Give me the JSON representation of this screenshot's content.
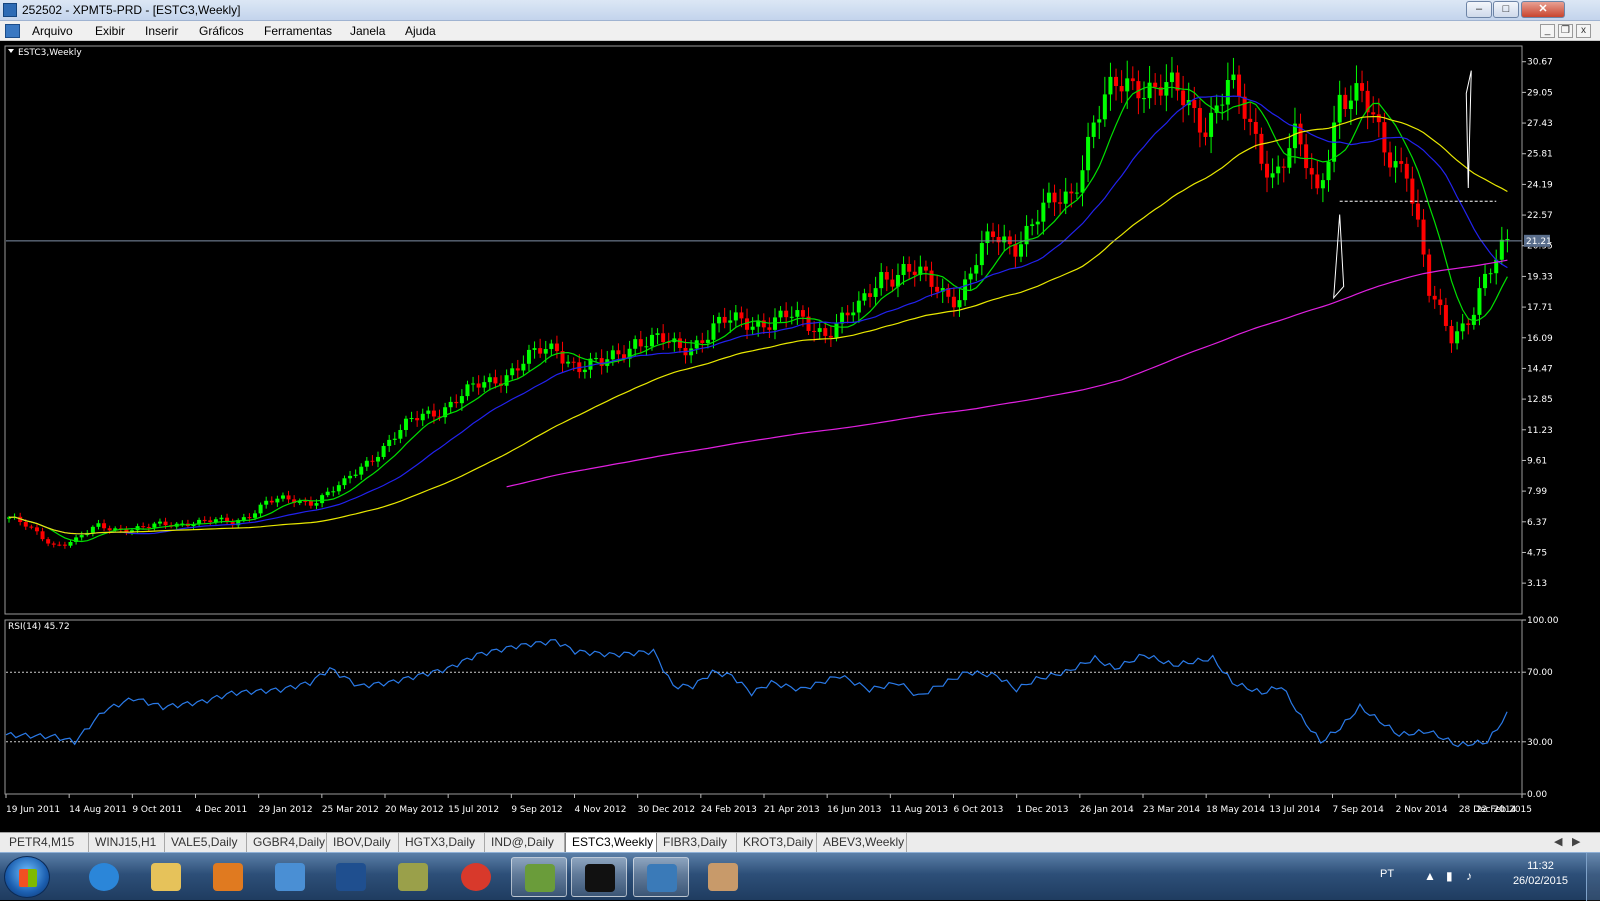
{
  "window": {
    "title": "252502 - XPMT5-PRD - [ESTC3,Weekly]"
  },
  "menu": [
    "Arquivo",
    "Exibir",
    "Inserir",
    "Gráficos",
    "Ferramentas",
    "Janela",
    "Ajuda"
  ],
  "chart_data": [
    {
      "type": "candlestick",
      "title": "ESTC3,Weekly",
      "ylim": [
        1.5,
        31.5
      ],
      "price_axis_ticks": [
        "30.67",
        "29.05",
        "27.43",
        "25.81",
        "24.19",
        "22.57",
        "20.95",
        "19.33",
        "17.71",
        "16.09",
        "14.47",
        "12.85",
        "11.23",
        "9.61",
        "7.99",
        "6.37",
        "4.75",
        "3.13"
      ],
      "current_price": "21.21",
      "date_labels": [
        "19 Jun 2011",
        "14 Aug 2011",
        "9 Oct 2011",
        "4 Dec 2011",
        "29 Jan 2012",
        "25 Mar 2012",
        "20 May 2012",
        "15 Jul 2012",
        "9 Sep 2012",
        "4 Nov 2012",
        "30 Dec 2012",
        "24 Feb 2013",
        "21 Apr 2013",
        "16 Jun 2013",
        "11 Aug 2013",
        "6 Oct 2013",
        "1 Dec 2013",
        "26 Jan 2014",
        "23 Mar 2014",
        "18 May 2014",
        "13 Jul 2014",
        "7 Sep 2014",
        "2 Nov 2014",
        "28 Dec 2014",
        "22 Feb 2015"
      ],
      "close_anchors": [
        [
          0,
          6.6
        ],
        [
          8,
          5.2
        ],
        [
          12,
          5.4
        ],
        [
          16,
          6.1
        ],
        [
          24,
          6.0
        ],
        [
          32,
          6.4
        ],
        [
          40,
          6.3
        ],
        [
          46,
          7.4
        ],
        [
          54,
          7.5
        ],
        [
          60,
          8.3
        ],
        [
          66,
          10.2
        ],
        [
          74,
          12.0
        ],
        [
          82,
          13.1
        ],
        [
          90,
          14.5
        ],
        [
          98,
          15.6
        ],
        [
          102,
          14.6
        ],
        [
          106,
          14.5
        ],
        [
          112,
          16.1
        ],
        [
          120,
          15.5
        ],
        [
          126,
          16.6
        ],
        [
          134,
          17.1
        ],
        [
          140,
          17.0
        ],
        [
          146,
          16.6
        ],
        [
          152,
          17.4
        ],
        [
          156,
          19.6
        ],
        [
          160,
          19.6
        ],
        [
          164,
          19.0
        ],
        [
          170,
          18.4
        ],
        [
          176,
          21.4
        ],
        [
          180,
          21.3
        ],
        [
          186,
          22.8
        ],
        [
          190,
          23.9
        ],
        [
          194,
          27.5
        ],
        [
          198,
          29.0
        ],
        [
          202,
          29.9
        ],
        [
          206,
          29.3
        ],
        [
          210,
          28.4
        ],
        [
          214,
          27.7
        ],
        [
          218,
          29.4
        ],
        [
          222,
          27.0
        ],
        [
          226,
          25.0
        ],
        [
          230,
          26.4
        ],
        [
          234,
          23.5
        ],
        [
          238,
          29.2
        ],
        [
          242,
          28.4
        ],
        [
          246,
          26.2
        ],
        [
          250,
          25.3
        ],
        [
          254,
          18.2
        ],
        [
          258,
          16.3
        ],
        [
          262,
          17.7
        ],
        [
          264,
          19.0
        ],
        [
          266,
          19.8
        ],
        [
          268,
          21.2
        ]
      ],
      "moving_averages": [
        {
          "period": 8,
          "color": "#00e000"
        },
        {
          "period": 21,
          "color": "#2222ee"
        },
        {
          "period": 50,
          "color": "#e8e800"
        },
        {
          "period": 200,
          "color": "#e020e0"
        }
      ],
      "colors": {
        "bull": "#00ff00",
        "bear": "#ff0000"
      }
    },
    {
      "type": "line",
      "title": "RSI(14) 45.72",
      "ylim": [
        0,
        100
      ],
      "ticks": [
        "100.00",
        "70.00",
        "30.00",
        "0.00"
      ],
      "levels": [
        70,
        30
      ],
      "anchors": [
        [
          0,
          34
        ],
        [
          10,
          33
        ],
        [
          14,
          30
        ],
        [
          20,
          48
        ],
        [
          26,
          55
        ],
        [
          32,
          50
        ],
        [
          40,
          53
        ],
        [
          46,
          58
        ],
        [
          56,
          60
        ],
        [
          62,
          64
        ],
        [
          66,
          72
        ],
        [
          72,
          62
        ],
        [
          78,
          64
        ],
        [
          84,
          68
        ],
        [
          90,
          72
        ],
        [
          96,
          80
        ],
        [
          104,
          85
        ],
        [
          112,
          88
        ],
        [
          116,
          82
        ],
        [
          124,
          80
        ],
        [
          132,
          82
        ],
        [
          136,
          62
        ],
        [
          140,
          62
        ],
        [
          144,
          70
        ],
        [
          148,
          68
        ],
        [
          152,
          58
        ],
        [
          156,
          64
        ],
        [
          162,
          60
        ],
        [
          170,
          68
        ],
        [
          176,
          60
        ],
        [
          182,
          64
        ],
        [
          186,
          56
        ],
        [
          190,
          62
        ],
        [
          196,
          70
        ],
        [
          202,
          68
        ],
        [
          206,
          60
        ],
        [
          210,
          66
        ],
        [
          216,
          70
        ],
        [
          222,
          78
        ],
        [
          226,
          72
        ],
        [
          232,
          80
        ],
        [
          238,
          74
        ],
        [
          246,
          78
        ],
        [
          250,
          64
        ],
        [
          256,
          58
        ],
        [
          260,
          62
        ],
        [
          264,
          44
        ],
        [
          268,
          30
        ],
        [
          272,
          38
        ],
        [
          276,
          50
        ],
        [
          280,
          42
        ],
        [
          284,
          34
        ],
        [
          290,
          36
        ],
        [
          296,
          28
        ],
        [
          302,
          30
        ],
        [
          306,
          45.7
        ]
      ],
      "color": "#2a7ae8"
    }
  ],
  "symbol_tabs": [
    "PETR4,M15",
    "WINJ15,H1",
    "VALE5,Daily",
    "GGBR4,Daily",
    "IBOV,Daily",
    "HGTX3,Daily",
    "IND@,Daily",
    "ESTC3,Weekly",
    "FIBR3,Daily",
    "KROT3,Daily",
    "ABEV3,Weekly"
  ],
  "active_tab": 7,
  "taskbar": {
    "items": [
      {
        "name": "internet-explorer-icon",
        "color": "#2b86d9"
      },
      {
        "name": "file-explorer-icon",
        "color": "#e6c25a"
      },
      {
        "name": "media-player-icon",
        "color": "#e07a20"
      },
      {
        "name": "remote-desktop-icon",
        "color": "#4a8fd4"
      },
      {
        "name": "hp-icon",
        "color": "#1f4f8f"
      },
      {
        "name": "gears-app-icon",
        "color": "#9aa04a"
      },
      {
        "name": "chrome-icon",
        "color": "#d8392b"
      },
      {
        "name": "metatrader-icon",
        "color": "#6a9c3a"
      },
      {
        "name": "xp-icon",
        "color": "#111111"
      },
      {
        "name": "picture-viewer-icon",
        "color": "#3a7ab8"
      },
      {
        "name": "paint-icon",
        "color": "#c89a6a"
      }
    ],
    "language": "PT",
    "time": "11:32",
    "date": "26/02/2015"
  }
}
